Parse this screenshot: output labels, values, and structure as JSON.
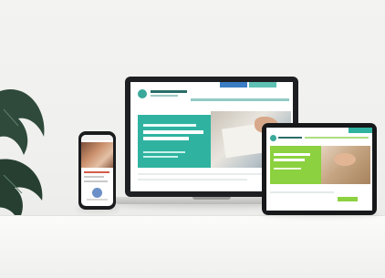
{
  "scene": {
    "description_visible_text": "",
    "devices": [
      {
        "kind": "laptop",
        "theme_color": "#2fb3a0"
      },
      {
        "kind": "tablet",
        "theme_color": "#8cd13f"
      },
      {
        "kind": "phone",
        "theme_color": "#d55a4a"
      }
    ]
  },
  "icons": {
    "plant": "plant-icon"
  },
  "colors": {
    "background": "#f0f0ee",
    "laptop_bezel": "#1e1f22",
    "accent_teal": "#2fb3a0",
    "accent_green": "#8cd13f",
    "accent_blue": "#3b7dc4"
  }
}
